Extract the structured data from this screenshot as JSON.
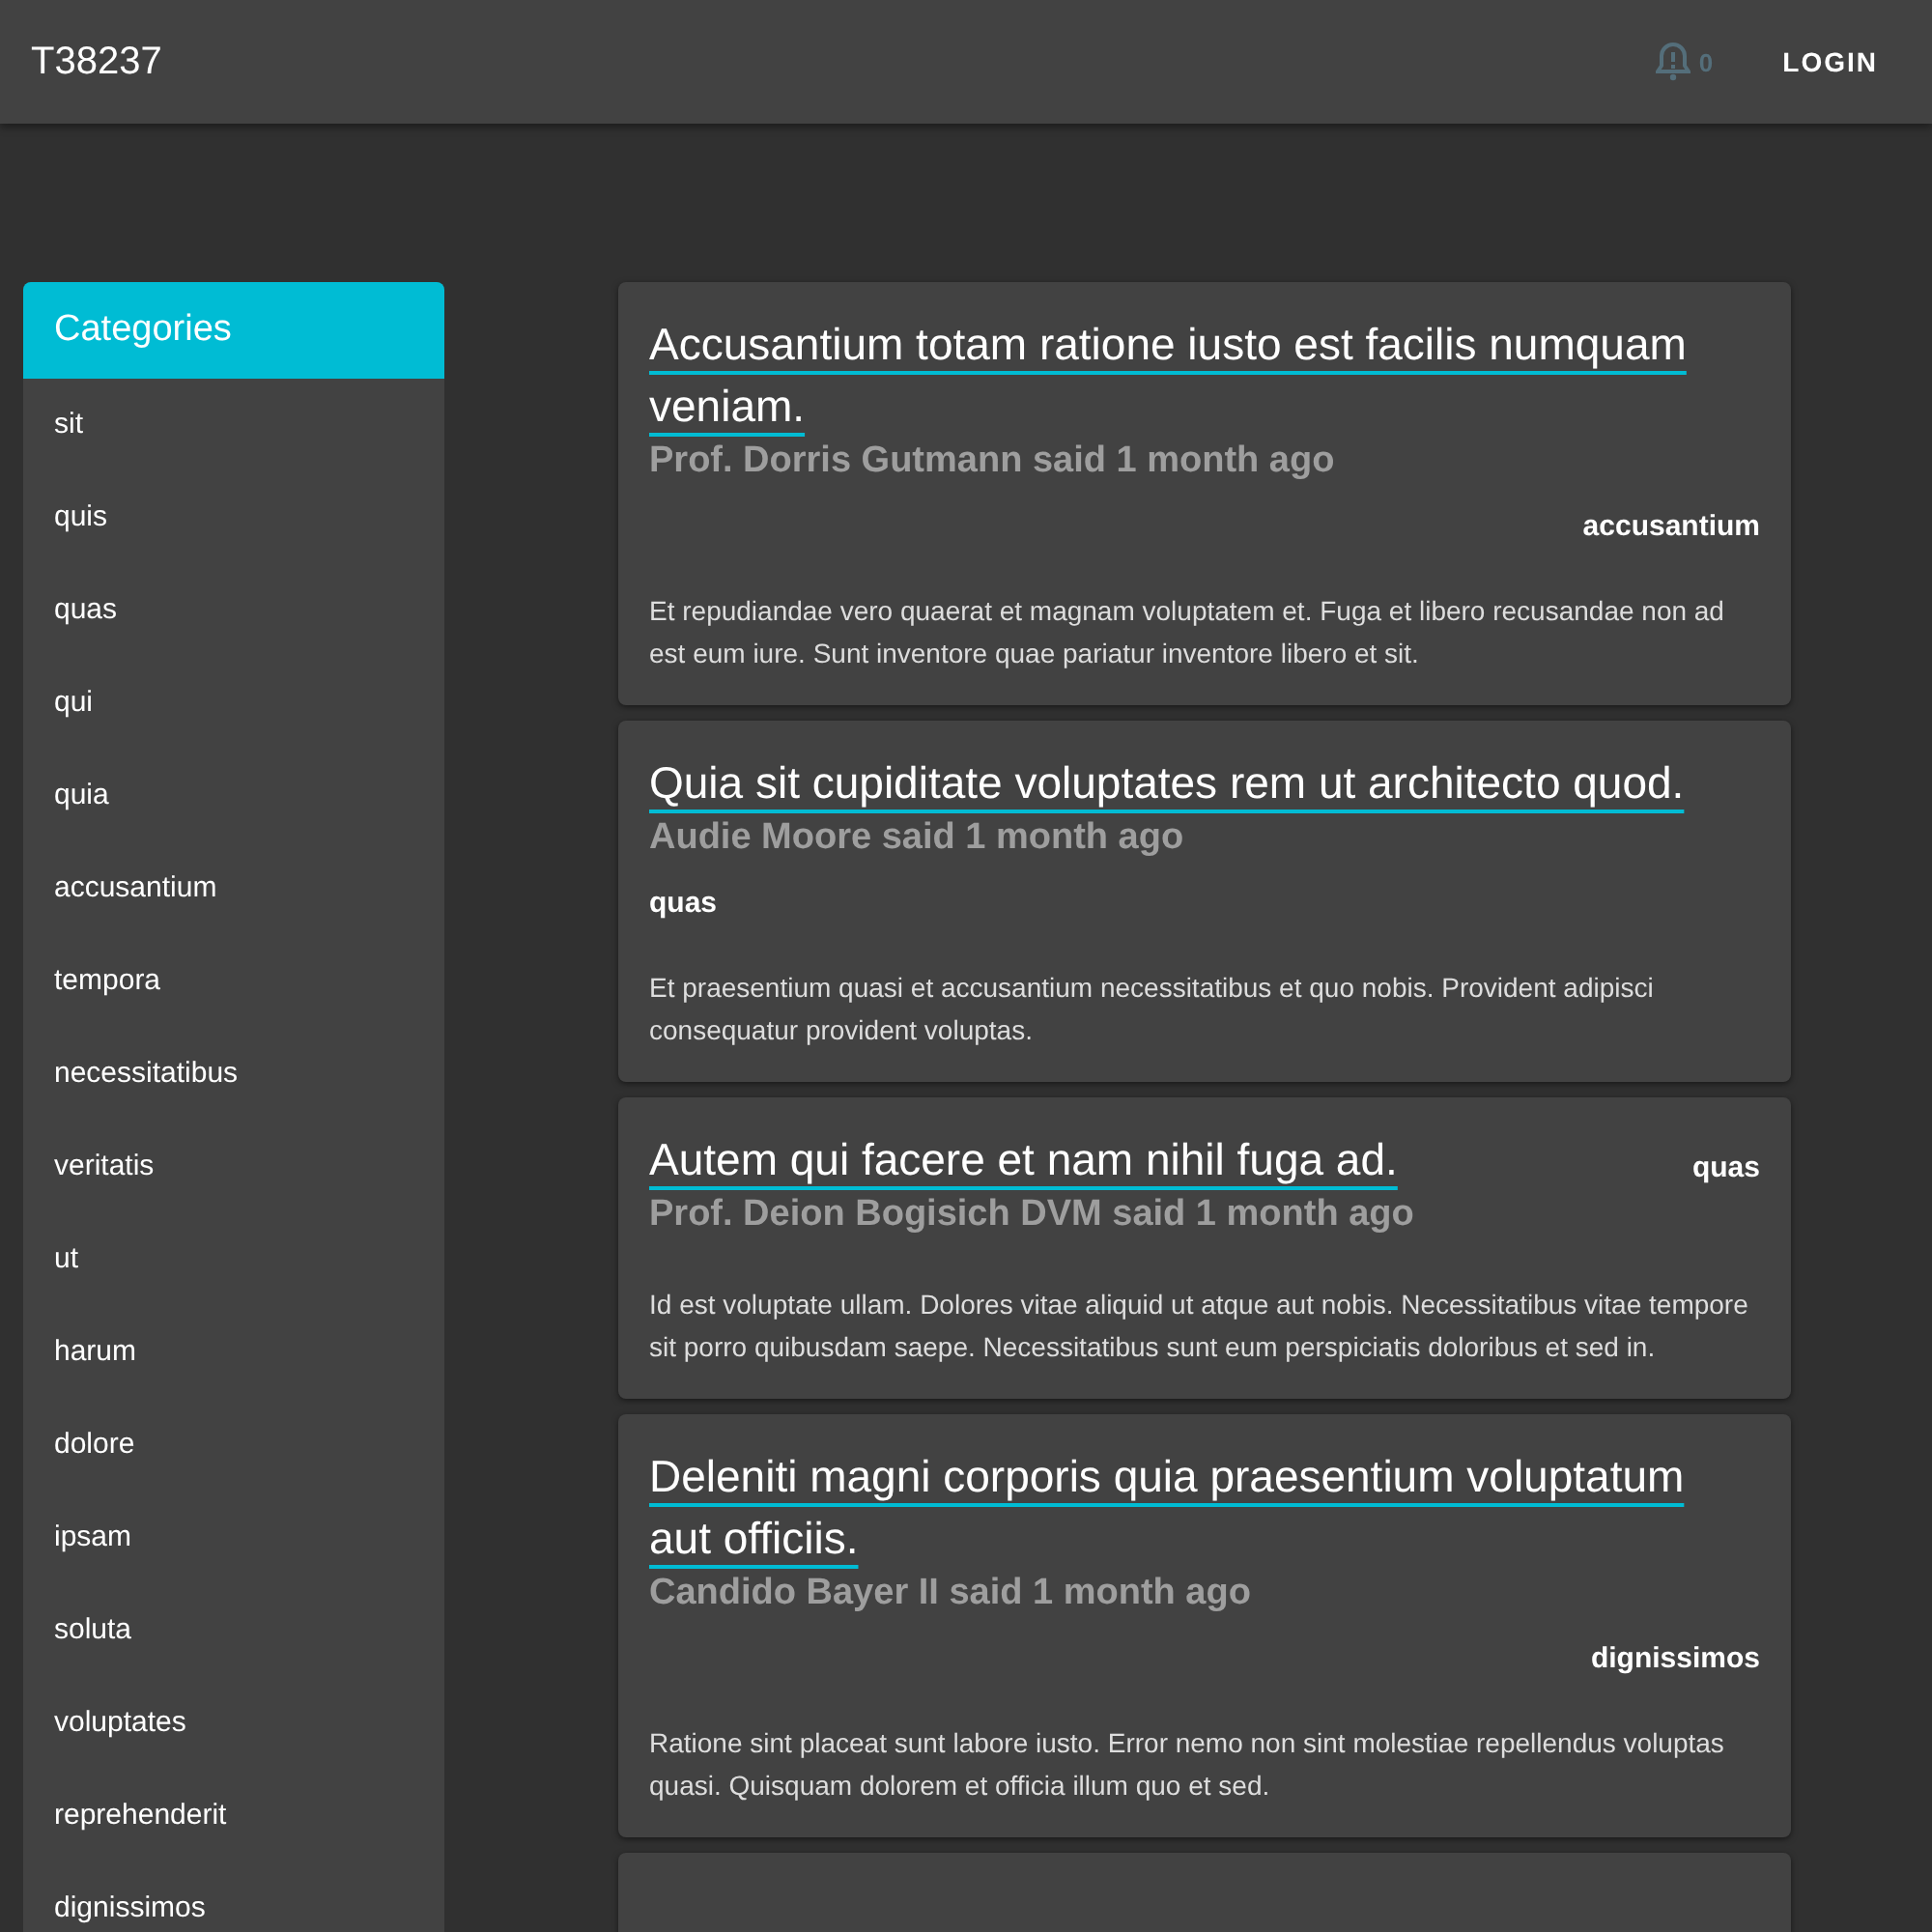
{
  "header": {
    "title": "T38237",
    "notifications": "0",
    "login": "LOGIN"
  },
  "sidebar": {
    "title": "Categories",
    "items": [
      "sit",
      "quis",
      "quas",
      "qui",
      "quia",
      "accusantium",
      "tempora",
      "necessitatibus",
      "veritatis",
      "ut",
      "harum",
      "dolore",
      "ipsam",
      "soluta",
      "voluptates",
      "reprehenderit",
      "dignissimos"
    ]
  },
  "posts": [
    {
      "title": "Accusantium totam ratione iusto est facilis numquam veniam.",
      "author": "Prof. Dorris Gutmann said 1 month ago",
      "tag": "accusantium",
      "kind": "right",
      "body": "Et repudiandae vero quaerat et magnam voluptatem et. Fuga et libero recusandae non ad est eum iure. Sunt inventore quae pariatur inventore libero et sit."
    },
    {
      "title": "Quia sit cupiditate voluptates rem ut architecto quod.",
      "author": "Audie Moore said 1 month ago",
      "tag": "quas",
      "kind": "left",
      "body": "Et praesentium quasi et accusantium necessitatibus et quo nobis. Provident adipisci consequatur provident voluptas."
    },
    {
      "title": "Autem qui facere et nam nihil fuga ad.",
      "author": "Prof. Deion Bogisich DVM said 1 month ago",
      "tag": "quas",
      "kind": "beside",
      "body": "Id est voluptate ullam. Dolores vitae aliquid ut atque aut nobis. Necessitatibus vitae tempore sit porro quibusdam saepe. Necessitatibus sunt eum perspiciatis doloribus et sed in."
    },
    {
      "title": "Deleniti magni corporis quia praesentium voluptatum aut officiis.",
      "author": "Candido Bayer II said 1 month ago",
      "tag": "dignissimos",
      "kind": "right",
      "body": "Ratione sint placeat sunt labore iusto. Error nemo non sint molestiae repellendus voluptas quasi. Quisquam dolorem et officia illum quo et sed."
    }
  ]
}
